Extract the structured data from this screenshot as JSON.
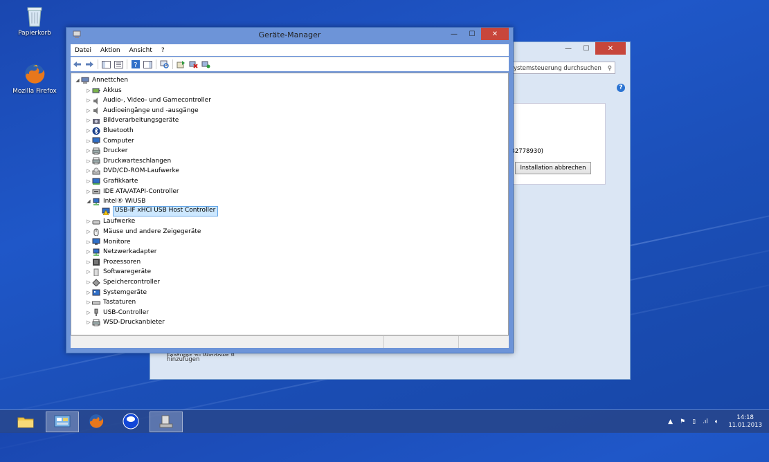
{
  "desktop": {
    "icons": [
      {
        "label": "Papierkorb",
        "icon": "recycle-bin-icon"
      },
      {
        "label": "Mozilla Firefox",
        "icon": "firefox-icon"
      }
    ]
  },
  "background_window": {
    "search_placeholder": "ystemsteuerung durchsuchen",
    "kb_text": "B2778930)",
    "cancel_button": "Installation abbrechen",
    "link_line1": "Features zu Windows 8",
    "link_line2": "hinzufügen"
  },
  "device_manager": {
    "title": "Geräte-Manager",
    "menu": [
      "Datei",
      "Aktion",
      "Ansicht",
      "?"
    ],
    "root": "Annettchen",
    "categories": [
      {
        "label": "Akkus",
        "icon": "battery-icon"
      },
      {
        "label": "Audio-, Video- und Gamecontroller",
        "icon": "speaker-icon"
      },
      {
        "label": "Audioeingänge und -ausgänge",
        "icon": "speaker-icon"
      },
      {
        "label": "Bildverarbeitungsgeräte",
        "icon": "camera-icon"
      },
      {
        "label": "Bluetooth",
        "icon": "bluetooth-icon"
      },
      {
        "label": "Computer",
        "icon": "computer-icon"
      },
      {
        "label": "Drucker",
        "icon": "printer-icon"
      },
      {
        "label": "Druckwarteschlangen",
        "icon": "printer-icon"
      },
      {
        "label": "DVD/CD-ROM-Laufwerke",
        "icon": "disc-drive-icon"
      },
      {
        "label": "Grafikkarte",
        "icon": "display-adapter-icon"
      },
      {
        "label": "IDE ATA/ATAPI-Controller",
        "icon": "ide-controller-icon"
      },
      {
        "label": "Intel® WiUSB",
        "icon": "network-icon",
        "expanded": true,
        "children": [
          {
            "label": "USB-IF xHCI USB Host Controller",
            "icon": "warning-device-icon"
          }
        ]
      },
      {
        "label": "Laufwerke",
        "icon": "disk-drive-icon"
      },
      {
        "label": "Mäuse und andere Zeigegeräte",
        "icon": "mouse-icon"
      },
      {
        "label": "Monitore",
        "icon": "monitor-icon"
      },
      {
        "label": "Netzwerkadapter",
        "icon": "network-icon"
      },
      {
        "label": "Prozessoren",
        "icon": "processor-icon"
      },
      {
        "label": "Softwaregeräte",
        "icon": "software-device-icon"
      },
      {
        "label": "Speichercontroller",
        "icon": "storage-controller-icon"
      },
      {
        "label": "Systemgeräte",
        "icon": "system-device-icon"
      },
      {
        "label": "Tastaturen",
        "icon": "keyboard-icon"
      },
      {
        "label": "USB-Controller",
        "icon": "usb-icon"
      },
      {
        "label": "WSD-Druckanbieter",
        "icon": "printer-icon"
      }
    ]
  },
  "taskbar": {
    "apps": [
      "explorer-icon",
      "control-panel-icon",
      "firefox-icon",
      "app-icon",
      "device-manager-icon"
    ],
    "time": "14:18",
    "date": "11.01.2013"
  },
  "colors": {
    "desktop": "#1f57c8",
    "window_frame": "#6d94d8",
    "close_button": "#c8463b",
    "selection": "#cde8ff"
  }
}
